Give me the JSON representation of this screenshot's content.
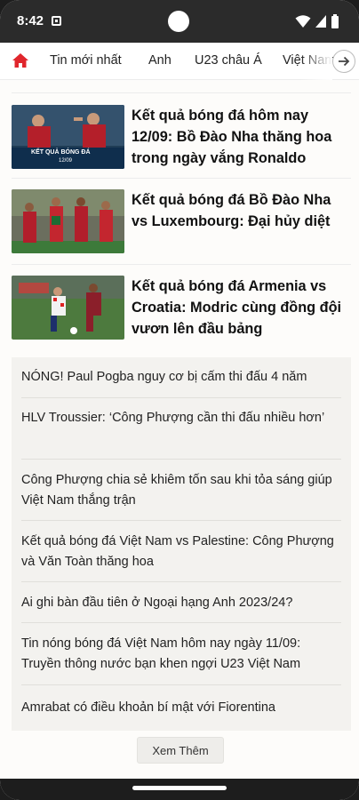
{
  "status_bar": {
    "time": "8:42"
  },
  "tabs": [
    {
      "label": "Tin mới nhất"
    },
    {
      "label": "Anh"
    },
    {
      "label": "U23 châu Á"
    },
    {
      "label": "Việt Nam"
    }
  ],
  "colors": {
    "accent": "#e0262c",
    "status_bar": "#2b2b2b",
    "page_bg": "#fdfcfa",
    "list_bg": "#f3f2ef"
  },
  "articles": [
    {
      "title": "Kết quả bóng đá hôm nay 12/09: Bồ Đào Nha thăng hoa trong ngày vắng Ronaldo",
      "thumb_caption": "KẾT QUẢ BÓNG ĐÁ",
      "thumb_date": "12/09"
    },
    {
      "title": "Kết quả bóng đá Bồ Đào Nha vs Luxembourg: Đại hủy diệt"
    },
    {
      "title": "Kết quả bóng đá Armenia vs Croatia: Modric cùng đồng đội vươn lên đầu bảng"
    }
  ],
  "headlines": [
    "NÓNG! Paul Pogba nguy cơ bị cấm thi đấu 4 năm",
    "HLV Troussier: ‘Công Phượng cần thi đấu nhiều hơn’",
    "Công Phượng chia sẻ khiêm tốn sau khi tỏa sáng giúp Việt Nam thắng trận",
    "Kết quả bóng đá Việt Nam vs Palestine: Công Phượng và Văn Toàn thăng hoa",
    "Ai ghi bàn đầu tiên ở Ngoại hạng Anh 2023/24?",
    "Tin nóng bóng đá Việt Nam hôm nay ngày 11/09: Truyền thông nước bạn khen ngợi U23 Việt Nam",
    "Amrabat có điều khoản bí mật với Fiorentina"
  ],
  "more_button": "Xem Thêm"
}
